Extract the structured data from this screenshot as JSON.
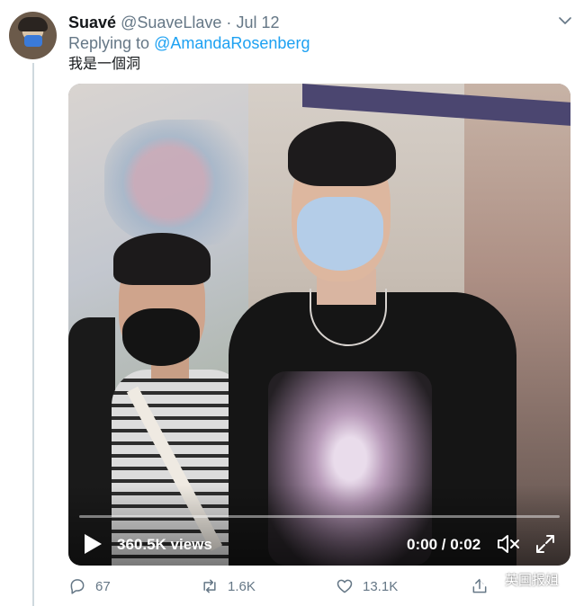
{
  "tweet": {
    "author_name": "Suavé",
    "handle": "@SuaveLlave",
    "separator": "·",
    "date": "Jul 12",
    "replying_prefix": "Replying to",
    "replying_mention": "@AmandaRosenberg",
    "text": "我是一個洞"
  },
  "video": {
    "views": "360.5K views",
    "time": "0:00 / 0:02",
    "progress": 0
  },
  "actions": {
    "replies": "67",
    "retweets": "1.6K",
    "likes": "13.1K"
  },
  "watermark": {
    "text": "英国报姐"
  },
  "colors": {
    "link": "#1da1f2",
    "secondary_text": "#657786",
    "primary_text": "#14171a"
  },
  "icons": [
    "chevron-down-icon",
    "play-icon",
    "mute-icon",
    "fullscreen-icon",
    "reply-icon",
    "retweet-icon",
    "like-icon",
    "share-icon"
  ]
}
